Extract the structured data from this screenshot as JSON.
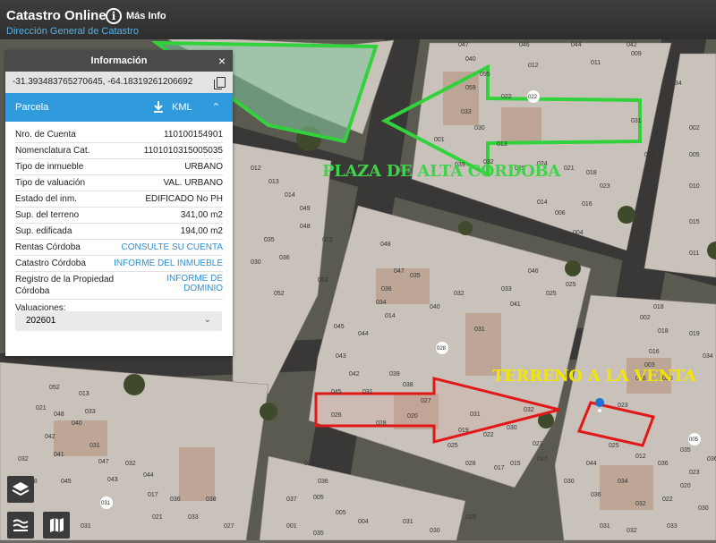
{
  "app": {
    "title": "Catastro Online",
    "subtitle": "Dirección General de Catastro",
    "more_info": "Más Info"
  },
  "panel": {
    "title": "Información",
    "close": "×",
    "coords": "-31.393483765270645, -64.18319261206692",
    "section": "Parcela",
    "kml": "KML",
    "rows": [
      {
        "key": "Nro. de Cuenta",
        "value": "110100154901"
      },
      {
        "key": "Nomenclatura Cat.",
        "value": "1101010315005035"
      },
      {
        "key": "Tipo de inmueble",
        "value": "URBANO"
      },
      {
        "key": "Tipo de valuación",
        "value": "VAL. URBANO"
      },
      {
        "key": "Estado del inm.",
        "value": "EDIFICADO No PH"
      },
      {
        "key": "Sup. del terreno",
        "value": "341,00 m2"
      },
      {
        "key": "Sup. edificada",
        "value": "194,00 m2"
      },
      {
        "key": "Rentas Córdoba",
        "value": "CONSULTE SU CUENTA"
      },
      {
        "key": "Catastro Córdoba",
        "value": "INFORME DEL INMUEBLE"
      },
      {
        "key": "Registro de la Propiedad Córdoba",
        "value": "INFORME DE DOMINIO"
      }
    ],
    "valuaciones_label": "Valuaciones:",
    "valuaciones_selected": "202601"
  },
  "map": {
    "plaza_label": "PLAZA DE ALTA CORDOBA",
    "terreno_label": "TERRENO A LA VENTA",
    "parcel_numbers": [
      "047",
      "046",
      "044",
      "042",
      "040",
      "012",
      "011",
      "009",
      "055",
      "059",
      "022",
      "034",
      "033",
      "030",
      "013",
      "031",
      "028",
      "001",
      "039",
      "032",
      "029",
      "024",
      "021",
      "018",
      "023",
      "016",
      "014",
      "006",
      "004",
      "002",
      "005",
      "010",
      "015",
      "011",
      "012",
      "013",
      "014",
      "049",
      "048",
      "012",
      "035",
      "030",
      "036",
      "052",
      "053",
      "048",
      "047",
      "036",
      "034",
      "035",
      "032",
      "033",
      "046",
      "025",
      "025",
      "041",
      "040",
      "031",
      "014",
      "045",
      "044",
      "043",
      "039",
      "042",
      "038",
      "045",
      "031",
      "027",
      "026",
      "028",
      "020",
      "031",
      "032",
      "019",
      "022",
      "030",
      "021",
      "015",
      "017",
      "017",
      "028",
      "025",
      "025",
      "016",
      "016",
      "023",
      "012",
      "002",
      "018",
      "018",
      "003",
      "019",
      "034",
      "020",
      "052",
      "013",
      "021",
      "048",
      "033",
      "040",
      "031",
      "042",
      "041",
      "047",
      "032",
      "048",
      "045",
      "032",
      "044",
      "043",
      "031",
      "017",
      "021",
      "036",
      "038",
      "033",
      "027",
      "025",
      "036",
      "037",
      "005",
      "005",
      "004",
      "001",
      "035",
      "031",
      "030",
      "029",
      "036",
      "034",
      "032",
      "022",
      "020",
      "023",
      "044",
      "030",
      "031",
      "032",
      "033",
      "030",
      "036",
      "035",
      "036",
      "037",
      "002",
      "003",
      "005",
      "006",
      "002"
    ],
    "colors": {
      "plaza_outline": "#31d23c",
      "terreno_outline": "#e01818",
      "plaza_text": "#3fd24a",
      "terreno_text": "#f2e600"
    }
  },
  "controls": {
    "layers_icon": "layers-icon",
    "legend_icon": "legend-icon",
    "map_icon": "map-icon"
  }
}
